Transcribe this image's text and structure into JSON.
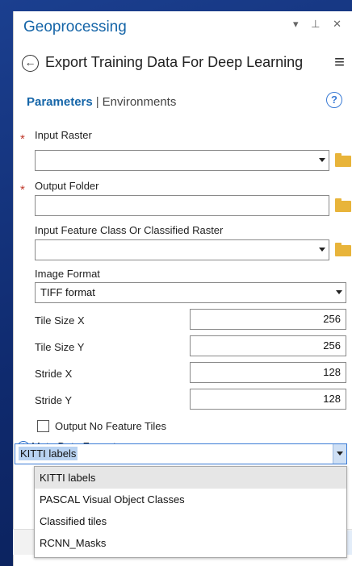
{
  "pane": {
    "title": "Geoprocessing",
    "controls": "▾ ⊥ ✕"
  },
  "tool": {
    "title": "Export Training Data For Deep Learning"
  },
  "tabs": {
    "parameters": "Parameters",
    "separator": "|",
    "environments": "Environments"
  },
  "params": {
    "input_raster": {
      "label": "Input Raster",
      "value": ""
    },
    "output_folder": {
      "label": "Output Folder",
      "value": ""
    },
    "input_feature": {
      "label": "Input Feature Class Or Classified Raster",
      "value": ""
    },
    "image_format": {
      "label": "Image Format",
      "value": "TIFF format"
    },
    "tile_size_x": {
      "label": "Tile Size X",
      "value": "256"
    },
    "tile_size_y": {
      "label": "Tile Size Y",
      "value": "256"
    },
    "stride_x": {
      "label": "Stride X",
      "value": "128"
    },
    "stride_y": {
      "label": "Stride Y",
      "value": "128"
    },
    "no_feature_tiles": {
      "label": "Output No Feature Tiles",
      "checked": false
    },
    "meta_data_format": {
      "label": "Meta Data Format",
      "value": "KITTI labels"
    }
  },
  "dropdown_options": [
    "KITTI labels",
    "PASCAL Visual Object Classes",
    "Classified tiles",
    "RCNN_Masks"
  ],
  "colors": {
    "accent": "#1565a8",
    "required": "#c0392b",
    "folder": "#e8b43a",
    "background": "#1b3f8f"
  }
}
